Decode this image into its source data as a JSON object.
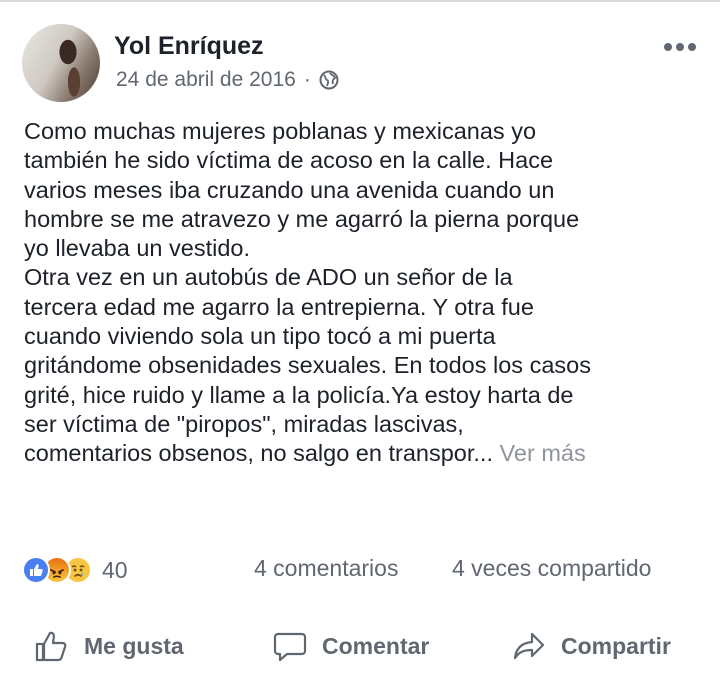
{
  "post": {
    "author": "Yol Enríquez",
    "date": "24 de abril de 2016",
    "separator": "·",
    "privacy_icon": "globe-icon",
    "text_lines": [
      "Como muchas mujeres poblanas y mexicanas yo",
      "también he sido víctima de acoso en la calle. Hace",
      "varios meses iba cruzando una avenida cuando un",
      "hombre se me atravezo y me agarró la pierna porque",
      "yo llevaba un vestido.",
      "Otra vez en  un autobús de ADO un señor de la",
      "tercera edad me agarro la entrepierna. Y otra fue",
      "cuando viviendo sola un tipo tocó a mi puerta",
      "gritándome obsenidades sexuales. En todos los casos",
      "grité, hice ruido y llame a la policía.Ya estoy harta de",
      "ser víctima de \"piropos\", miradas lascivas,",
      "comentarios obsenos, no salgo en  transpor..."
    ],
    "see_more": "Ver más"
  },
  "stats": {
    "reactions": [
      "like-icon",
      "angry-icon",
      "sad-icon"
    ],
    "reaction_count": "40",
    "comments": "4 comentarios",
    "shares": "4 veces compartido"
  },
  "actions": {
    "like": "Me gusta",
    "comment": "Comentar",
    "share": "Compartir"
  },
  "colors": {
    "text": "#1d2129",
    "secondary": "#616770",
    "like_blue": "#4a7ff2",
    "reaction_yellow": "#f7c53f"
  }
}
